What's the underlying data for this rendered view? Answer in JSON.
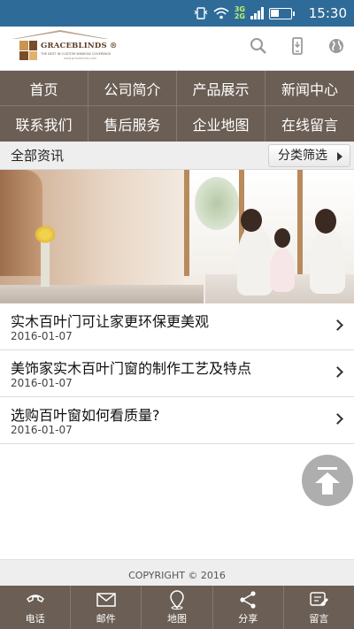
{
  "status_bar": {
    "time": "15:30",
    "network_top": "3G",
    "network_bottom": "2G"
  },
  "header": {
    "logo": {
      "brand": "GRACEBLINDS ®",
      "tagline": "THE BEST IN CUSTOM WINDOW COVERINGS",
      "tagline_small": "www.graceblinds.com"
    },
    "icons": [
      "search-icon",
      "phone-icon",
      "globe-icon"
    ]
  },
  "nav": {
    "items": [
      {
        "label": "首页"
      },
      {
        "label": "公司简介"
      },
      {
        "label": "产品展示"
      },
      {
        "label": "新闻中心"
      },
      {
        "label": "联系我们"
      },
      {
        "label": "售后服务"
      },
      {
        "label": "企业地图"
      },
      {
        "label": "在线留言"
      }
    ]
  },
  "category_bar": {
    "title": "全部资讯",
    "filter_label": "分类筛选"
  },
  "news": {
    "items": [
      {
        "title": "实木百叶门可让家更环保更美观",
        "date": "2016-01-07"
      },
      {
        "title": "美饰家实木百叶门窗的制作工艺及特点",
        "date": "2016-01-07"
      },
      {
        "title": "选购百叶窗如何看质量?",
        "date": "2016-01-07"
      }
    ]
  },
  "footer": {
    "copyright": "COPYRIGHT © 2016"
  },
  "tabbar": {
    "items": [
      {
        "label": "电话",
        "icon": "phone-icon"
      },
      {
        "label": "邮件",
        "icon": "mail-icon"
      },
      {
        "label": "地图",
        "icon": "map-pin-icon"
      },
      {
        "label": "分享",
        "icon": "share-icon"
      },
      {
        "label": "留言",
        "icon": "message-edit-icon"
      }
    ]
  },
  "colors": {
    "status_bar": "#2f6b98",
    "nav_bg": "#6b5e54",
    "category_bg": "#eeeeee",
    "back_to_top": "#aeaeae"
  }
}
